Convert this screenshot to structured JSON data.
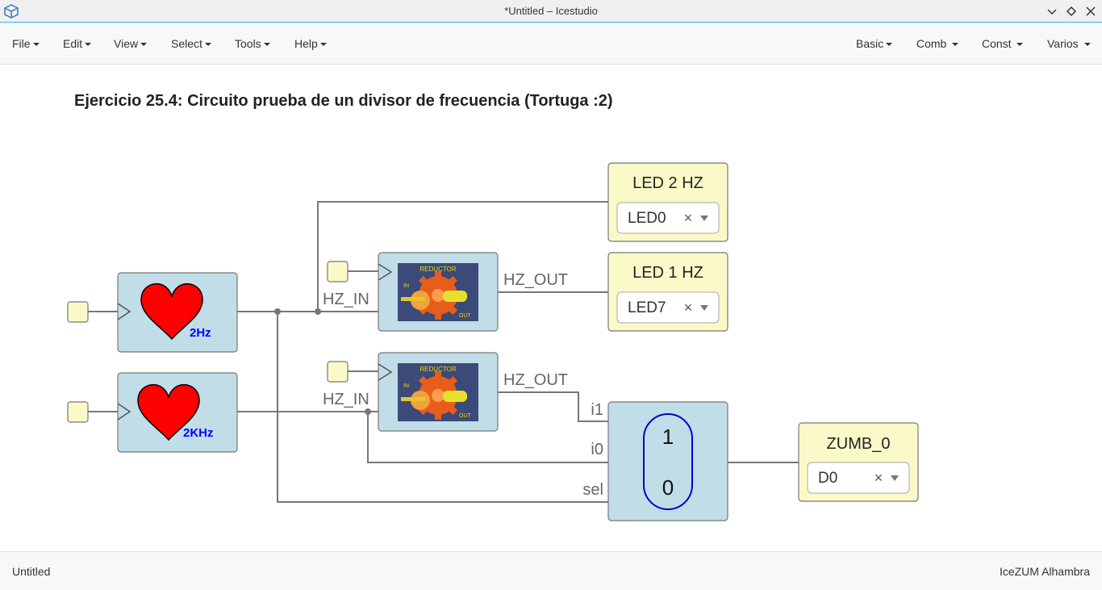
{
  "window": {
    "title": "*Untitled – Icestudio",
    "app_icon": "icestudio-cube-icon"
  },
  "menubar": {
    "left": [
      {
        "label": "File"
      },
      {
        "label": "Edit"
      },
      {
        "label": "View"
      },
      {
        "label": "Select"
      },
      {
        "label": "Tools"
      },
      {
        "label": "Help"
      }
    ],
    "right": [
      {
        "label": "Basic"
      },
      {
        "label": "Comb"
      },
      {
        "label": "Const"
      },
      {
        "label": "Varios"
      }
    ]
  },
  "heading": "Ejercicio 25.4: Circuito prueba de un divisor de frecuencia (Tortuga :2)",
  "blocks": {
    "heart_top_label": "2Hz",
    "heart_bottom_label": "2KHz",
    "reductor_title": "REDUCTOR",
    "reductor_in": "IN",
    "reductor_out": "OUT",
    "hz_in": "HZ_IN",
    "hz_out": "HZ_OUT",
    "led2": {
      "title": "LED 2 HZ",
      "value": "LED0"
    },
    "led1": {
      "title": "LED 1 HZ",
      "value": "LED7"
    },
    "zumb": {
      "title": "ZUMB_0",
      "value": "D0"
    },
    "mux": {
      "i1": "i1",
      "i0": "i0",
      "sel": "sel",
      "top": "1",
      "bottom": "0"
    },
    "clear": "×"
  },
  "status": {
    "left": "Untitled",
    "right": "IceZUM Alhambra"
  },
  "colors": {
    "block_blue": "#c0dde8",
    "block_yellow": "#fafac8",
    "heart": "#ff0000",
    "accent": "#3daee9"
  }
}
